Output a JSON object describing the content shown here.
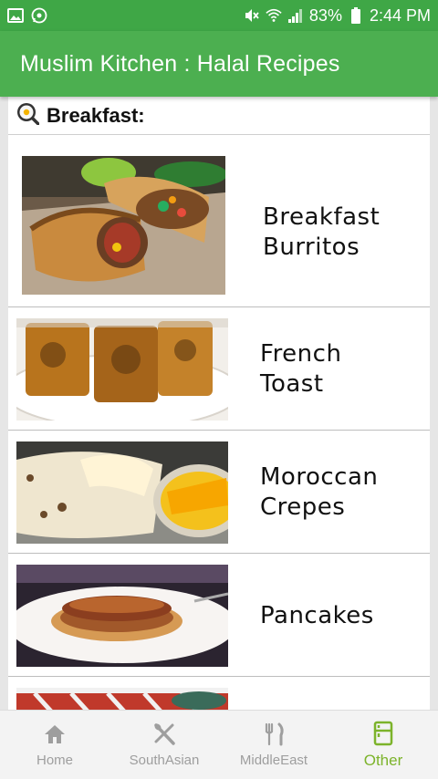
{
  "status_bar": {
    "battery": "83%",
    "time": "2:44 PM",
    "left_icons": [
      "image-icon",
      "whatsapp-icon"
    ],
    "right_icons": [
      "mute-icon",
      "wifi-icon",
      "signal-icon",
      "battery-icon"
    ]
  },
  "app_bar": {
    "title": "Muslim Kitchen : Halal Recipes"
  },
  "section": {
    "icon": "frying-pan-egg-icon",
    "title": "Breakfast:"
  },
  "recipes": [
    {
      "name_line1": "Breakfast",
      "name_line2": "Burritos"
    },
    {
      "name_line1": "French",
      "name_line2": "Toast"
    },
    {
      "name_line1": "Moroccan",
      "name_line2": "Crepes"
    },
    {
      "name_line1": "Pancakes",
      "name_line2": ""
    }
  ],
  "bottom_nav": {
    "items": [
      {
        "label": "Home",
        "icon": "home-icon",
        "active": false
      },
      {
        "label": "SouthAsian",
        "icon": "fork-spoon-icon",
        "active": false
      },
      {
        "label": "MiddleEast",
        "icon": "fork-knife-icon",
        "active": false
      },
      {
        "label": "Other",
        "icon": "fridge-icon",
        "active": true
      }
    ]
  },
  "colors": {
    "status_bar": "#3fa746",
    "app_bar": "#4caf50",
    "active_nav": "#7cb32a",
    "inactive_nav": "#9e9e9e"
  }
}
